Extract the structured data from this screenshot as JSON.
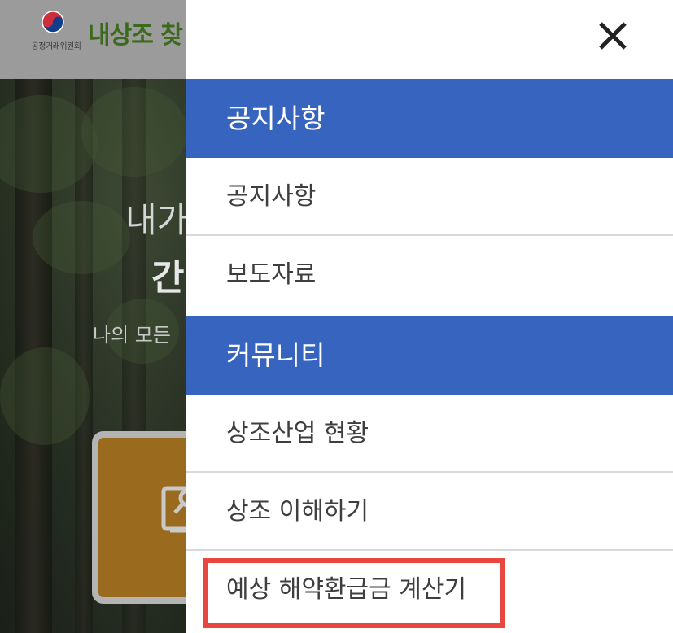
{
  "background": {
    "org_name": "공정거래위원회",
    "site_title": "내상조 찾",
    "hero": {
      "line1": "내가",
      "line2": "간",
      "line3": "나의 모든"
    }
  },
  "drawer": {
    "close_icon": "close-icon",
    "sections": [
      {
        "title": "공지사항",
        "items": [
          "공지사항",
          "보도자료"
        ]
      },
      {
        "title": "커뮤니티",
        "items": [
          "상조산업 현황",
          "상조 이해하기",
          "예상 해약환급금 계산기"
        ]
      }
    ]
  },
  "colors": {
    "section_header": "#3664bf",
    "highlight": "#e8463e",
    "site_title": "#3c6a1c",
    "card": "#9a6a1f"
  }
}
